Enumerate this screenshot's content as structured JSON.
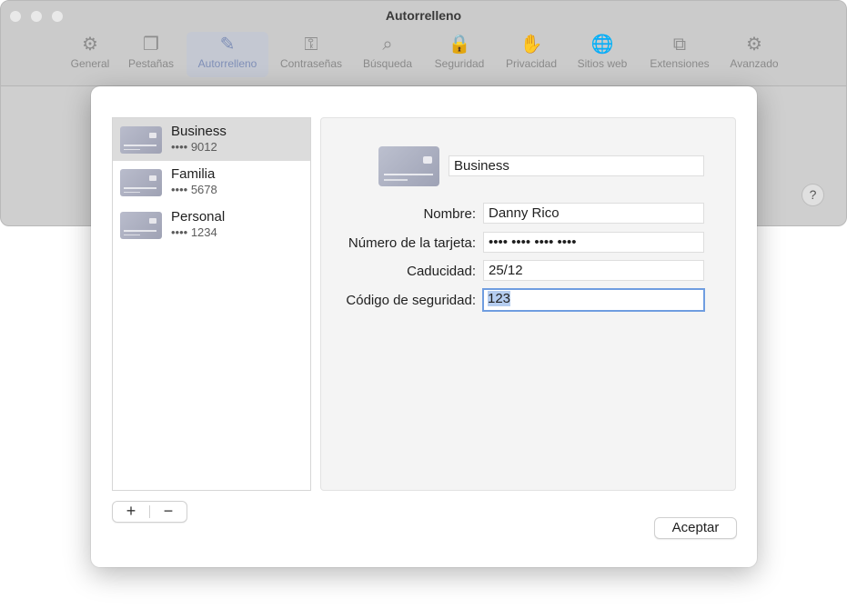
{
  "window": {
    "title": "Autorrelleno",
    "help_label": "?"
  },
  "toolbar": {
    "tabs": [
      {
        "label": "General",
        "icon": "gear-icon",
        "glyph": "⚙"
      },
      {
        "label": "Pestañas",
        "icon": "tabs-icon",
        "glyph": "❐"
      },
      {
        "label": "Autorrelleno",
        "icon": "autofill-icon",
        "glyph": "✎",
        "active": true
      },
      {
        "label": "Contraseñas",
        "icon": "key-icon",
        "glyph": "⚿"
      },
      {
        "label": "Búsqueda",
        "icon": "search-icon",
        "glyph": "⌕"
      },
      {
        "label": "Seguridad",
        "icon": "lock-icon",
        "glyph": "🔒"
      },
      {
        "label": "Privacidad",
        "icon": "hand-icon",
        "glyph": "✋"
      },
      {
        "label": "Sitios web",
        "icon": "globe-icon",
        "glyph": "🌐"
      },
      {
        "label": "Extensiones",
        "icon": "puzzle-icon",
        "glyph": "⧉"
      },
      {
        "label": "Avanzado",
        "icon": "advanced-gears-icon",
        "glyph": "⚙"
      }
    ]
  },
  "cards": [
    {
      "name": "Business",
      "number": "•••• 9012",
      "selected": true
    },
    {
      "name": "Familia",
      "number": "•••• 5678"
    },
    {
      "name": "Personal",
      "number": "•••• 1234"
    }
  ],
  "detail": {
    "description": "Business",
    "fields": [
      {
        "label": "Nombre:",
        "value": "Danny Rico"
      },
      {
        "label": "Número de la tarjeta:",
        "value": "•••• •••• •••• ••••"
      },
      {
        "label": "Caducidad:",
        "value": "25/12"
      },
      {
        "label": "Código de seguridad:",
        "value": "123"
      }
    ]
  },
  "controls": {
    "add_label": "+",
    "remove_label": "−",
    "accept_label": "Aceptar"
  }
}
